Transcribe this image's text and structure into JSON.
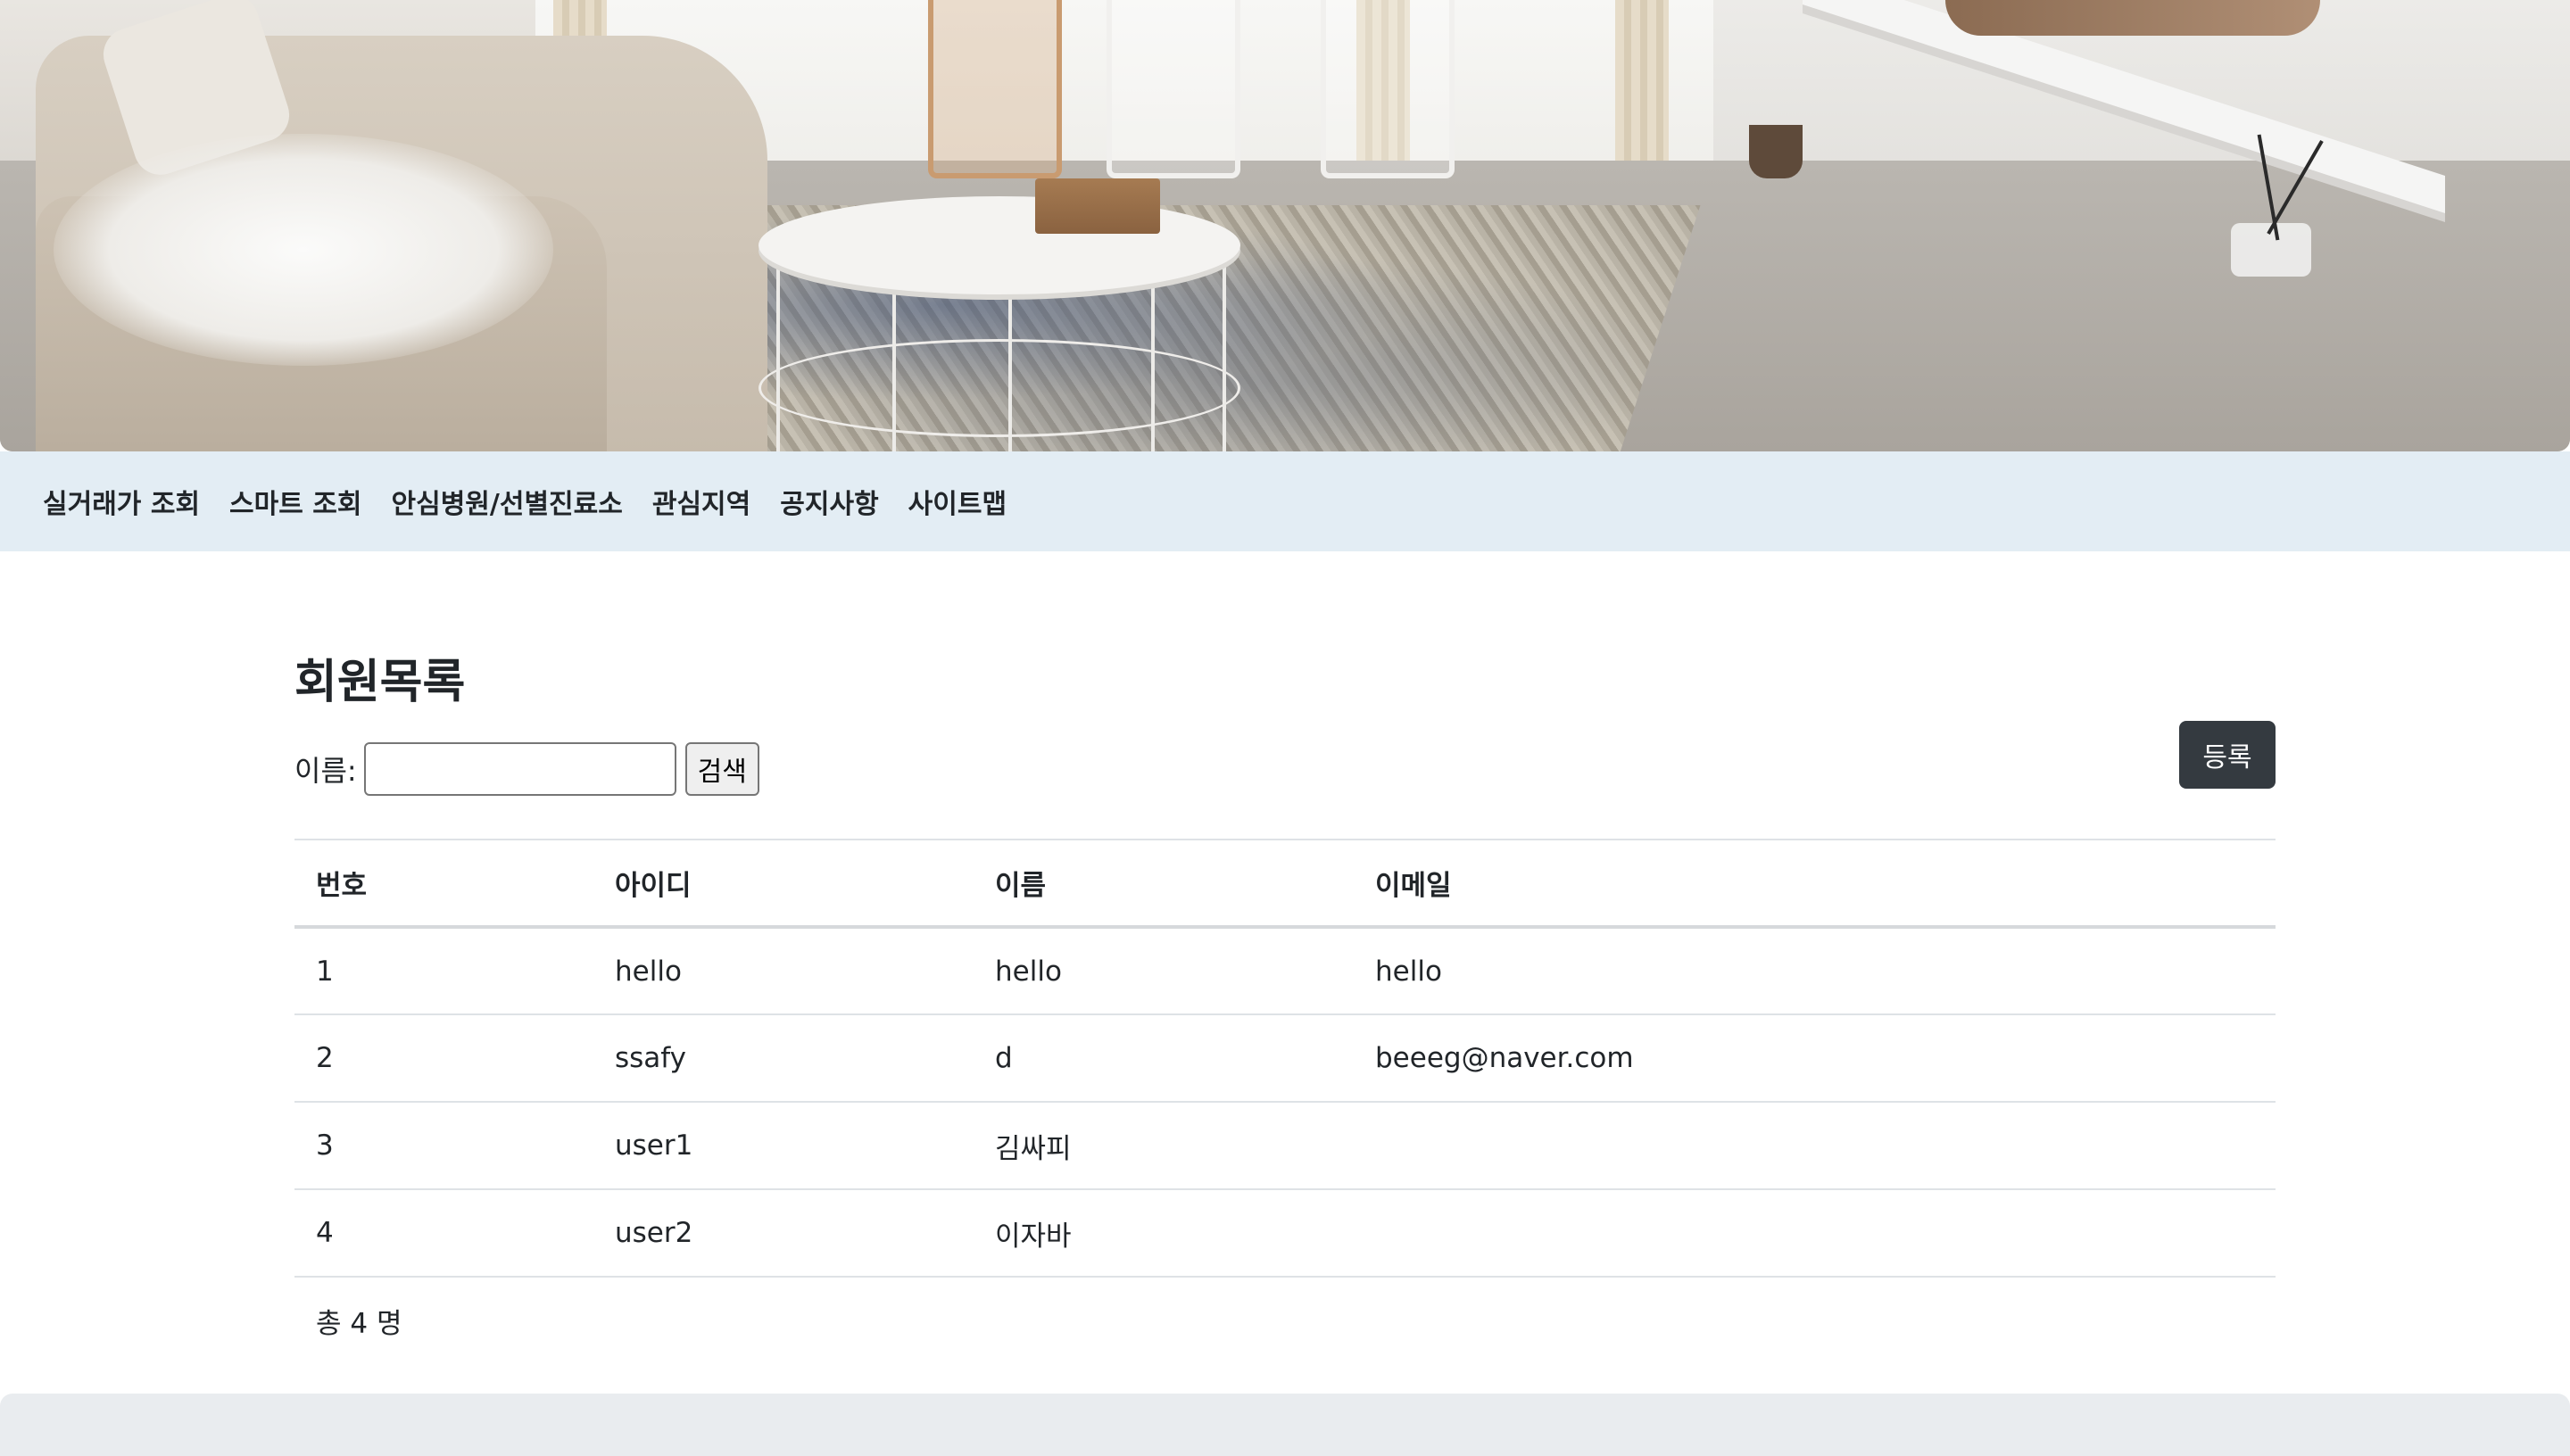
{
  "nav": {
    "items": [
      {
        "label": "실거래가 조회"
      },
      {
        "label": "스마트 조회"
      },
      {
        "label": "안심병원/선별진료소"
      },
      {
        "label": "관심지역"
      },
      {
        "label": "공지사항"
      },
      {
        "label": "사이트맵"
      }
    ]
  },
  "page": {
    "title": "회원목록"
  },
  "search": {
    "label": "이름:",
    "value": "",
    "placeholder": "",
    "button_label": "검색"
  },
  "register_button_label": "등록",
  "table": {
    "headers": [
      "번호",
      "아이디",
      "이름",
      "이메일"
    ],
    "rows": [
      {
        "no": "1",
        "id": "hello",
        "name": "hello",
        "email": "hello"
      },
      {
        "no": "2",
        "id": "ssafy",
        "name": "d",
        "email": "beeeg@naver.com"
      },
      {
        "no": "3",
        "id": "user1",
        "name": "김싸피",
        "email": ""
      },
      {
        "no": "4",
        "id": "user2",
        "name": "이자바",
        "email": ""
      }
    ],
    "total_text": "총 4 명"
  },
  "colors": {
    "navbar_bg": "#e3edf4",
    "register_button_bg": "#343a40",
    "footer_bg": "#e9ecef"
  },
  "icons": {
    "hero": "living-room-photo"
  }
}
